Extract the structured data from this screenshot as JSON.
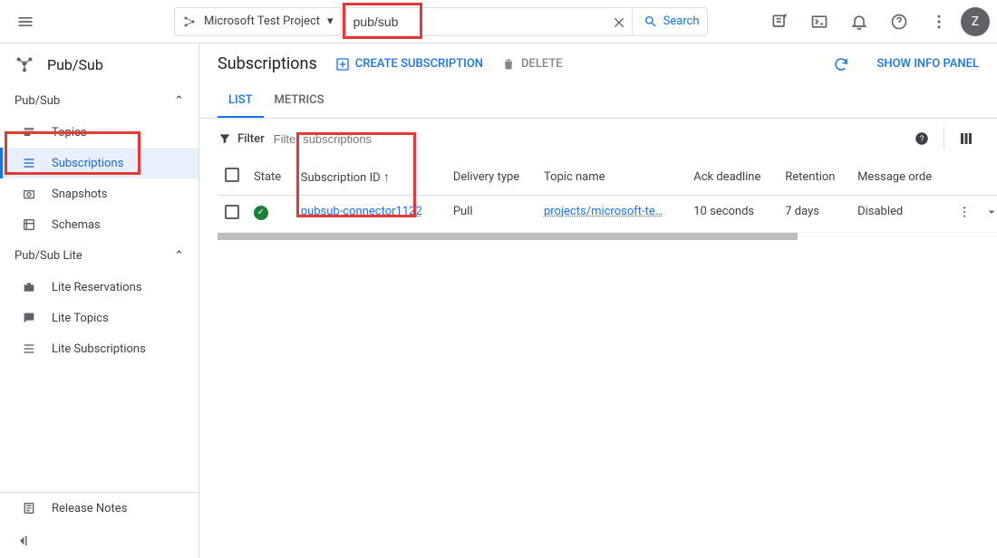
{
  "topbar": {
    "project_name": "Microsoft Test Project",
    "search_value": "pub/sub",
    "search_button": "Search",
    "avatar_initial": "Z"
  },
  "sidebar": {
    "product_title": "Pub/Sub",
    "sections": [
      {
        "label": "Pub/Sub",
        "items": [
          {
            "label": "Topics"
          },
          {
            "label": "Subscriptions",
            "active": true
          },
          {
            "label": "Snapshots"
          },
          {
            "label": "Schemas"
          }
        ]
      },
      {
        "label": "Pub/Sub Lite",
        "items": [
          {
            "label": "Lite Reservations"
          },
          {
            "label": "Lite Topics"
          },
          {
            "label": "Lite Subscriptions"
          }
        ]
      }
    ],
    "release_notes": "Release Notes"
  },
  "main": {
    "title": "Subscriptions",
    "create_label": "CREATE SUBSCRIPTION",
    "delete_label": "DELETE",
    "show_info_panel": "SHOW INFO PANEL",
    "tabs": {
      "list": "LIST",
      "metrics": "METRICS"
    },
    "filter_label": "Filter",
    "filter_placeholder": "Filter subscriptions",
    "table": {
      "headers": {
        "state": "State",
        "subscription_id": "Subscription ID",
        "delivery_type": "Delivery type",
        "topic_name": "Topic name",
        "ack_deadline": "Ack deadline",
        "retention": "Retention",
        "message_ordering": "Message orde"
      },
      "rows": [
        {
          "state": "active",
          "subscription_id": "pubsub-connector1122",
          "delivery_type": "Pull",
          "topic_name": "projects/microsoft-te…",
          "ack_deadline": "10 seconds",
          "retention": "7 days",
          "message_ordering": "Disabled"
        }
      ]
    }
  }
}
